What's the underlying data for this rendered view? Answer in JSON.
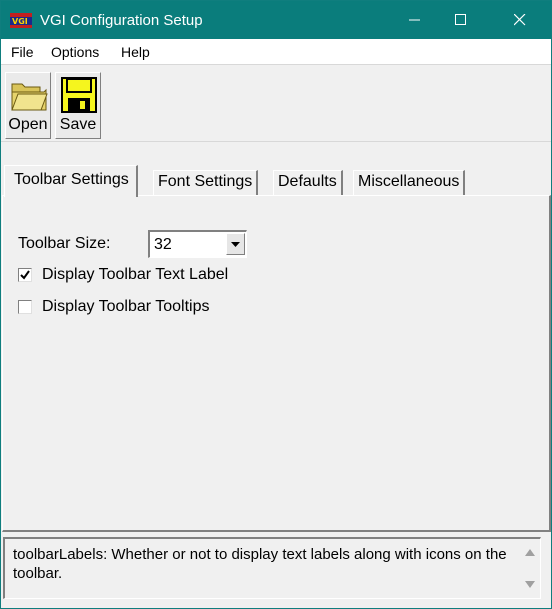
{
  "window": {
    "title": "VGI Configuration Setup",
    "app_icon": "vgi-flag-icon",
    "controls": [
      "minimize-icon",
      "maximize-icon",
      "close-icon"
    ]
  },
  "menu": {
    "items": [
      {
        "label": "File"
      },
      {
        "label": "Options"
      },
      {
        "label": "Help"
      }
    ]
  },
  "toolbar": {
    "buttons": [
      {
        "label": "Open",
        "icon": "folder-icon"
      },
      {
        "label": "Save",
        "icon": "floppy-disk-icon"
      }
    ]
  },
  "tabs": [
    {
      "label": "Toolbar Settings",
      "active": true
    },
    {
      "label": "Font Settings",
      "active": false
    },
    {
      "label": "Defaults",
      "active": false
    },
    {
      "label": "Miscellaneous",
      "active": false
    }
  ],
  "toolbar_settings": {
    "size_label": "Toolbar Size:",
    "size_value": "32",
    "options": [
      {
        "label": "Display Toolbar Text Label",
        "checked": true
      },
      {
        "label": "Display Toolbar Tooltips",
        "checked": false
      }
    ]
  },
  "description": {
    "text": " toolbarLabels: Whether or not to display text labels along with icons on the toolbar."
  },
  "colors": {
    "titlebar": "#0a7d7c",
    "window_bg": "#f0f0f0",
    "folder": "#e6d36b",
    "floppy": "#f5f51e"
  }
}
